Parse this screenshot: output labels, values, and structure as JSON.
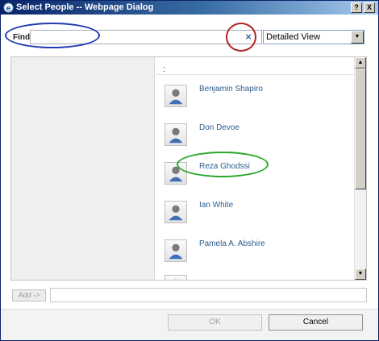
{
  "window": {
    "title": "Select People -- Webpage Dialog",
    "help_button": "?",
    "close_button": "X"
  },
  "find": {
    "label": "Find",
    "value": "",
    "clear_label": "×"
  },
  "view_select": {
    "selected": "Detailed View"
  },
  "results": {
    "header": ":",
    "people": [
      {
        "name": "Benjamin Shapiro"
      },
      {
        "name": "Don Devoe"
      },
      {
        "name": "Reza Ghodssi"
      },
      {
        "name": "Ian White"
      },
      {
        "name": "Pamela A. Abshire"
      }
    ]
  },
  "add": {
    "button_label": "Add ->",
    "value": ""
  },
  "footer": {
    "ok_label": "OK",
    "cancel_label": "Cancel"
  },
  "colors": {
    "titlebar_start": "#0a246a",
    "titlebar_end": "#a6caf0",
    "name_link": "#2c5c8c",
    "annotation_blue": "#1f3ab3",
    "annotation_red": "#b02121",
    "annotation_green": "#2aa82a"
  },
  "icons": {
    "title": "ie-page-icon",
    "person": "user-icon",
    "clear": "close-icon",
    "dropdown": "chevron-down-icon"
  }
}
